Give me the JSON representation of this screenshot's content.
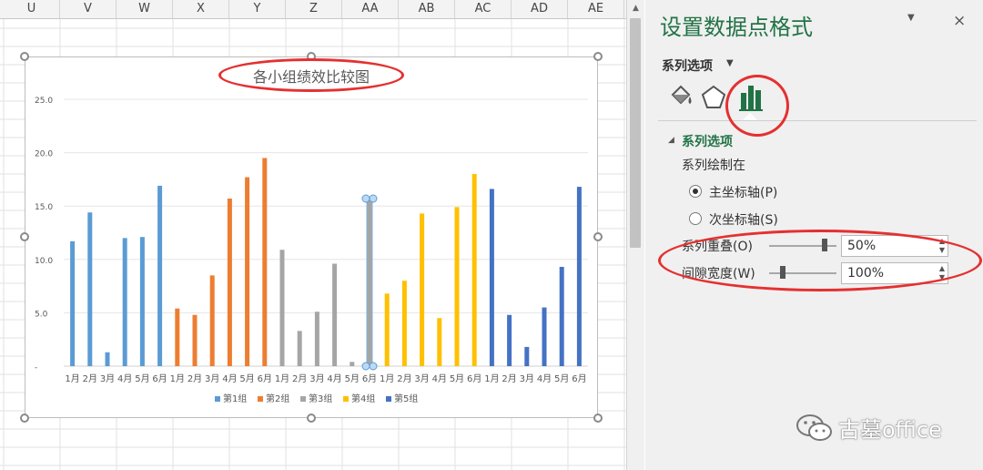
{
  "sheet": {
    "columns": [
      "U",
      "V",
      "W",
      "X",
      "Y",
      "Z",
      "AA",
      "AB",
      "AC",
      "AD",
      "AE"
    ]
  },
  "chart": {
    "title": "各小组绩效比较图"
  },
  "chart_data": {
    "type": "bar",
    "title": "各小组绩效比较图",
    "xlabel": "",
    "ylabel": "",
    "ylim": [
      0,
      25
    ],
    "y_ticks": [
      "-",
      "5.0",
      "10.0",
      "15.0",
      "20.0",
      "25.0"
    ],
    "categories": [
      "1月",
      "2月",
      "3月",
      "4月",
      "5月",
      "6月"
    ],
    "legend_position": "bottom",
    "series": [
      {
        "name": "第1组",
        "color": "#5b9bd5",
        "values": [
          11.7,
          14.4,
          1.3,
          12.0,
          12.1,
          16.9
        ]
      },
      {
        "name": "第2组",
        "color": "#ed7d31",
        "values": [
          5.4,
          4.8,
          8.5,
          15.7,
          17.7,
          19.5
        ]
      },
      {
        "name": "第3组",
        "color": "#a5a5a5",
        "values": [
          10.9,
          3.3,
          5.1,
          9.6,
          0.4,
          15.7
        ]
      },
      {
        "name": "第4组",
        "color": "#ffc000",
        "values": [
          6.8,
          8.0,
          14.3,
          4.5,
          14.9,
          18.0
        ]
      },
      {
        "name": "第5组",
        "color": "#4472c4",
        "values": [
          16.6,
          4.8,
          1.8,
          5.5,
          9.3,
          16.8
        ]
      }
    ]
  },
  "pane": {
    "title": "设置数据点格式",
    "dropdown_icon": "chevron-down-icon",
    "close_glyph": "×",
    "series_options_menu": "系列选项",
    "section_title": "系列选项",
    "plot_on_label": "系列绘制在",
    "primary_axis": "主坐标轴(P)",
    "secondary_axis": "次坐标轴(S)",
    "overlap_label": "系列重叠(O)",
    "overlap_value": "50%",
    "overlap_level": 0.5,
    "gap_label": "间隙宽度(W)",
    "gap_value": "100%",
    "gap_level": 0.2
  },
  "watermark": {
    "text": "古墓office"
  },
  "colors": {
    "accent": "#217346",
    "annotation_red": "#e53030"
  }
}
